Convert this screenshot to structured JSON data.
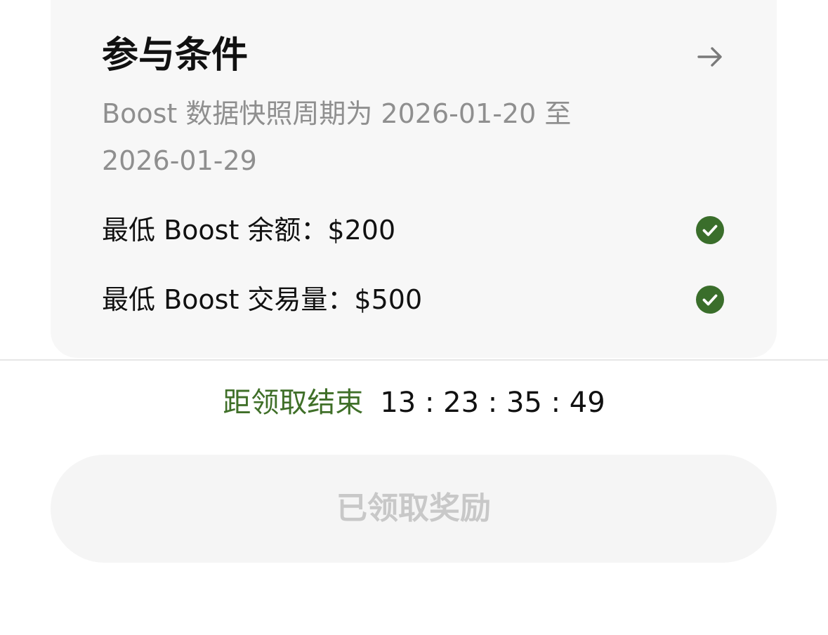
{
  "section": {
    "title": "参与条件",
    "arrow_icon": "arrow-right-icon",
    "description": "Boost 数据快照周期为 2026-01-20 至 2026-01-29",
    "conditions": [
      {
        "label": "最低 Boost 余额：$200",
        "met": true,
        "icon": "check-circle-icon"
      },
      {
        "label": "最低 Boost 交易量：$500",
        "met": true,
        "icon": "check-circle-icon"
      }
    ]
  },
  "countdown": {
    "label": "距领取结束",
    "time": "13 : 23 : 35 : 49"
  },
  "claim_button": {
    "label": "已领取奖励",
    "disabled": true
  },
  "colors": {
    "accent_green": "#3f6f28",
    "check_green": "#3a6e2b",
    "card_bg": "#f7f7f7",
    "muted_text": "#8f8f8f",
    "disabled_text": "#c8c8c8"
  }
}
